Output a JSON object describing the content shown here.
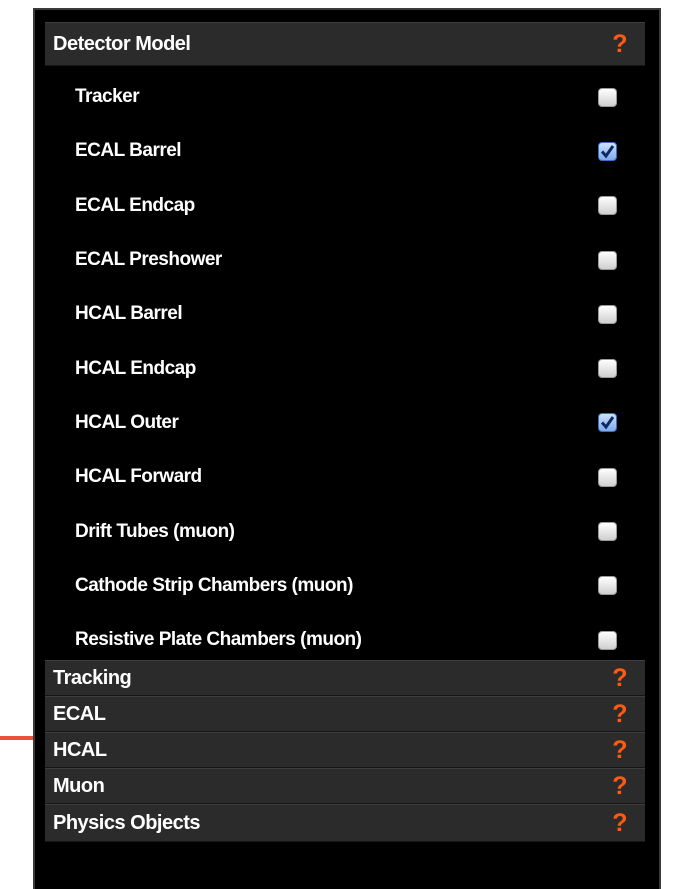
{
  "header": {
    "title": "Detector Model"
  },
  "detectors": [
    {
      "label": "Tracker",
      "checked": false
    },
    {
      "label": "ECAL Barrel",
      "checked": true
    },
    {
      "label": "ECAL Endcap",
      "checked": false
    },
    {
      "label": "ECAL Preshower",
      "checked": false
    },
    {
      "label": "HCAL Barrel",
      "checked": false
    },
    {
      "label": "HCAL Endcap",
      "checked": false
    },
    {
      "label": "HCAL Outer",
      "checked": true
    },
    {
      "label": "HCAL Forward",
      "checked": false
    },
    {
      "label": "Drift Tubes (muon)",
      "checked": false
    },
    {
      "label": "Cathode Strip Chambers (muon)",
      "checked": false
    },
    {
      "label": "Resistive Plate Chambers (muon)",
      "checked": false
    }
  ],
  "sections": [
    {
      "label": "Tracking"
    },
    {
      "label": "ECAL"
    },
    {
      "label": "HCAL"
    },
    {
      "label": "Muon"
    },
    {
      "label": "Physics Objects"
    }
  ],
  "help_icon": {
    "glyph": "?",
    "name": "help-icon",
    "color": "#ff5a14"
  },
  "colors": {
    "panel_bg": "#000000",
    "header_bg": "#2b2b2b",
    "checked_accent": "#3d6fc0"
  }
}
